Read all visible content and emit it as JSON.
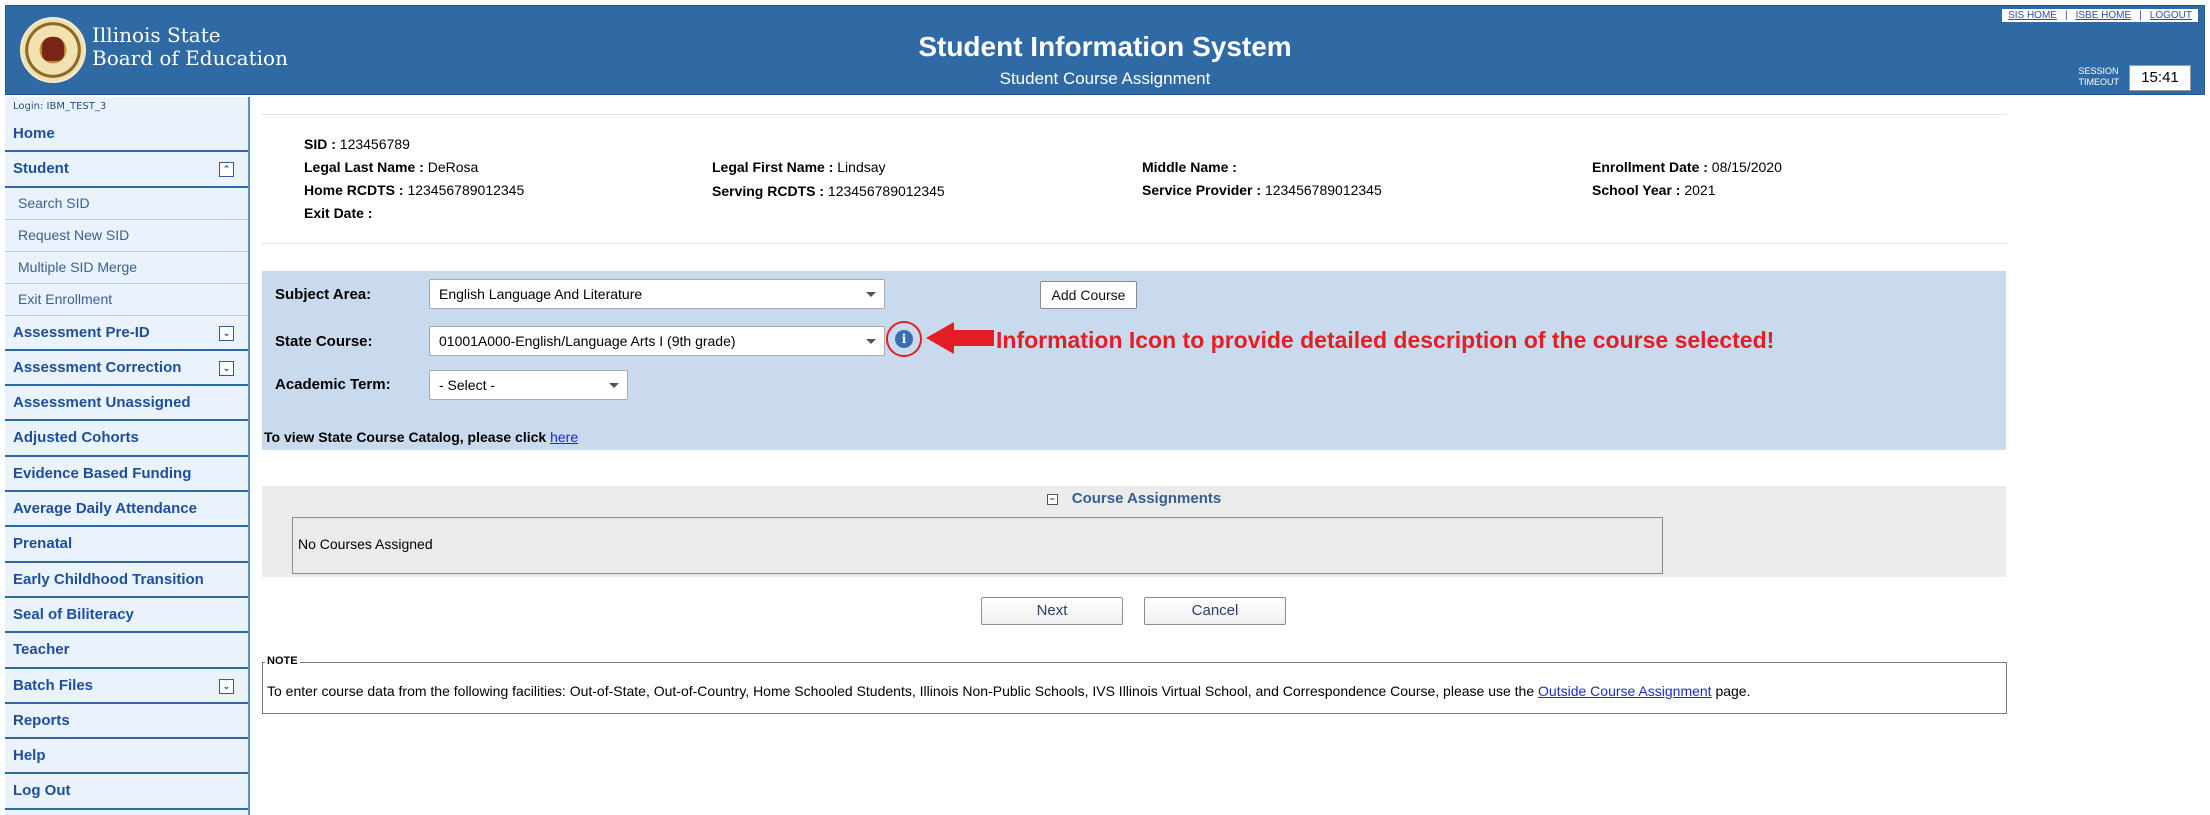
{
  "header": {
    "logo_line1": "Illinois State",
    "logo_line2": "Board of Education",
    "title": "Student Information System",
    "subtitle": "Student Course Assignment",
    "links": [
      "SIS HOME",
      "ISBE HOME",
      "LOGOUT"
    ],
    "session_label_1": "SESSION",
    "session_label_2": "TIMEOUT",
    "session_time": "15:41"
  },
  "sidebar": {
    "login": "Login: IBM_TEST_3",
    "items": [
      {
        "label": "Home",
        "type": "item"
      },
      {
        "label": "Student",
        "type": "item",
        "toggle": "collapse"
      },
      {
        "label": "Search SID",
        "type": "sub"
      },
      {
        "label": "Request New SID",
        "type": "sub"
      },
      {
        "label": "Multiple SID Merge",
        "type": "sub"
      },
      {
        "label": "Exit Enrollment",
        "type": "sub"
      },
      {
        "label": "Assessment Pre-ID",
        "type": "item",
        "toggle": "expand"
      },
      {
        "label": "Assessment Correction",
        "type": "item",
        "toggle": "expand"
      },
      {
        "label": "Assessment Unassigned",
        "type": "item"
      },
      {
        "label": "Adjusted Cohorts",
        "type": "item"
      },
      {
        "label": "Evidence Based Funding",
        "type": "item"
      },
      {
        "label": "Average Daily Attendance",
        "type": "item"
      },
      {
        "label": "Prenatal",
        "type": "item"
      },
      {
        "label": "Early Childhood Transition",
        "type": "item"
      },
      {
        "label": "Seal of Biliteracy",
        "type": "item"
      },
      {
        "label": "Teacher",
        "type": "item"
      },
      {
        "label": "Batch Files",
        "type": "item",
        "toggle": "expand"
      },
      {
        "label": "Reports",
        "type": "item"
      },
      {
        "label": "Help",
        "type": "item"
      },
      {
        "label": "Log Out",
        "type": "item"
      }
    ]
  },
  "student": {
    "sid_label": "SID :",
    "sid": "123456789",
    "last_name_label": "Legal Last Name :",
    "last_name": "DeRosa",
    "first_name_label": "Legal First Name :",
    "first_name": "Lindsay",
    "middle_name_label": "Middle Name :",
    "middle_name": "",
    "enrollment_date_label": "Enrollment Date :",
    "enrollment_date": "08/15/2020",
    "home_rcdts_label": "Home RCDTS :",
    "home_rcdts": "123456789012345",
    "serving_rcdts_label": "Serving RCDTS :",
    "serving_rcdts": "123456789012345",
    "service_provider_label": "Service Provider :",
    "service_provider": "123456789012345",
    "school_year_label": "School Year :",
    "school_year": "2021",
    "exit_date_label": "Exit Date :",
    "exit_date": ""
  },
  "form": {
    "subject_area_label": "Subject Area:",
    "subject_area_value": "English Language And Literature",
    "add_course_label": "Add Course",
    "state_course_label": "State Course:",
    "state_course_value": "01001A000-English/Language Arts I (9th grade)",
    "academic_term_label": "Academic Term:",
    "academic_term_value": "- Select -",
    "info_icon_glyph": "i",
    "annotation": "Information Icon to provide detailed description of the course selected!",
    "catalog_text": "To view State Course Catalog, please click",
    "catalog_link": "here"
  },
  "assignments": {
    "collapse_glyph": "−",
    "header": "Course Assignments",
    "empty_text": "No Courses Assigned"
  },
  "buttons": {
    "next": "Next",
    "cancel": "Cancel"
  },
  "note": {
    "legend": "NOTE",
    "text_before": "To enter course data from the following facilities: Out-of-State, Out-of-Country, Home Schooled Students, Illinois Non-Public Schools, IVS Illinois Virtual School, and Correspondence Course, please use the",
    "link": "Outside Course Assignment",
    "text_after": "page."
  },
  "colors": {
    "header_bg": "#2f6aa5",
    "sidebar_bg": "#eaf3fc",
    "form_panel_bg": "#c9d9ee",
    "annotation_red": "#e31e24"
  }
}
